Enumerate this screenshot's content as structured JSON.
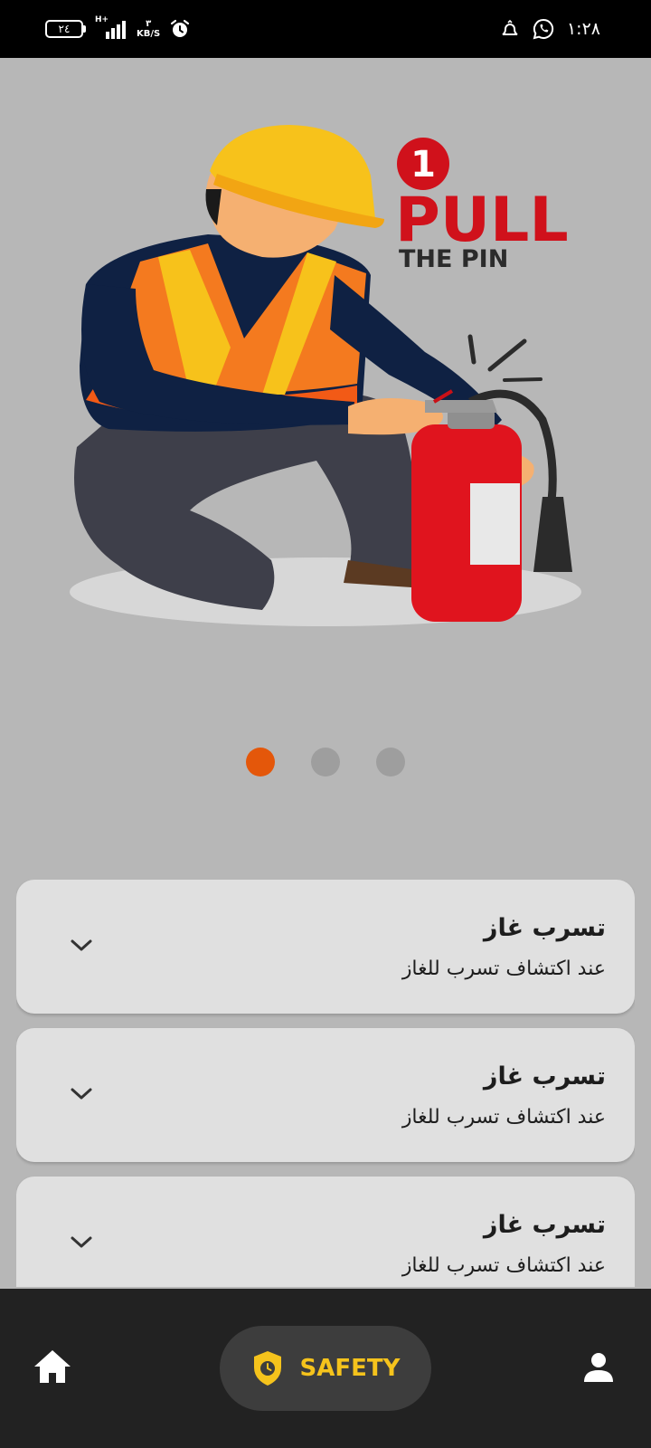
{
  "status_bar": {
    "time": "١:٢٨",
    "battery": "٢٤",
    "network_type": "H+",
    "speed_value": "٣",
    "speed_unit": "KB/S",
    "icons": [
      "battery-icon",
      "signal-icon",
      "alarm-icon",
      "notification-icon",
      "whatsapp-icon"
    ]
  },
  "illustration": {
    "step_number": "1",
    "headline": "PULL",
    "subline": "THE PIN",
    "colors": {
      "headline": "#d0111b",
      "subline": "#2b2b2b",
      "extinguisher": "#e0141e",
      "helmet": "#f7c21b",
      "vest": "#f47a1f",
      "shirt": "#0f2143"
    }
  },
  "pager": {
    "count": 3,
    "active_index": 0,
    "active_color": "#e4570a",
    "inactive_color": "#9e9e9e"
  },
  "cards": [
    {
      "title": "تسرب غاز",
      "subtitle": "عند اكتشاف تسرب للغاز"
    },
    {
      "title": "تسرب غاز",
      "subtitle": "عند اكتشاف تسرب للغاز"
    },
    {
      "title": "تسرب غاز",
      "subtitle": "عند اكتشاف تسرب للغاز"
    }
  ],
  "bottom_nav": {
    "home_icon": "home-icon",
    "safety_label": "SAFETY",
    "safety_icon": "shield-clock-icon",
    "profile_icon": "person-icon",
    "accent_color": "#f5c31c"
  }
}
